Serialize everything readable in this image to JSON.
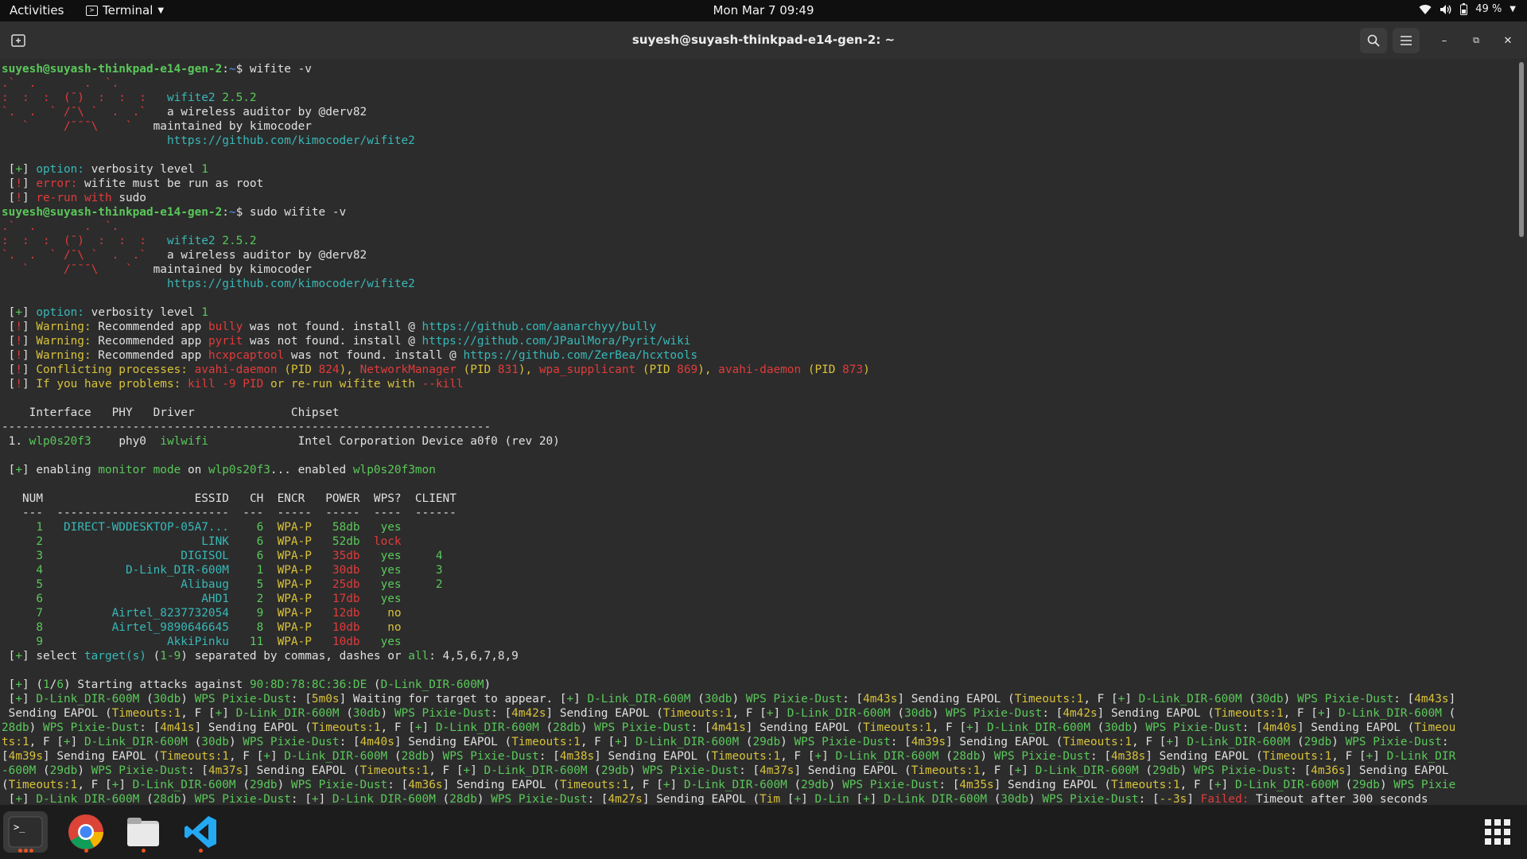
{
  "topbar": {
    "activities": "Activities",
    "app_menu": "Terminal",
    "clock": "Mon Mar 7  09:49",
    "battery": "49 %"
  },
  "window": {
    "title": "suyesh@suyash-thinkpad-e14-gen-2: ~"
  },
  "terminal": {
    "prompt_user": "suyesh@suyash-thinkpad-e14-gen-2",
    "prompt_path": "~",
    "cmd1": "wifite -v",
    "cmd2": "sudo wifite -v",
    "banner_name": "wifite2",
    "banner_version": "2.5.2",
    "banner_l2": "a wireless auditor by @derv82",
    "banner_l3": "maintained by kimocoder",
    "banner_url": "https://github.com/kimocoder/wifite2",
    "opt_label": "option:",
    "opt_text": "verbosity level",
    "opt_value": "1",
    "err_label": "error:",
    "err_text": "wifite must be run as root",
    "rerun": "re-run with",
    "sudo": "sudo",
    "warnings": [
      {
        "app": "bully",
        "url": "https://github.com/aanarchyy/bully"
      },
      {
        "app": "pyrit",
        "url": "https://github.com/JPaulMora/Pyrit/wiki"
      },
      {
        "app": "hcxpcaptool",
        "url": "https://github.com/ZerBea/hcxtools"
      }
    ],
    "iface_header": [
      "Interface",
      "PHY",
      "Driver",
      "Chipset"
    ],
    "iface_row": {
      "num": "1.",
      "iface": "wlp0s20f3",
      "phy": "phy0",
      "driver": "iwlwifi",
      "chipset": "Intel Corporation Device a0f0 (rev 20)"
    },
    "monitor_iface": "wlp0s20f3",
    "monitor_new": "wlp0s20f3mon",
    "targets_header": [
      "NUM",
      "ESSID",
      "CH",
      "ENCR",
      "POWER",
      "WPS?",
      "CLIENT"
    ],
    "targets": [
      {
        "num": "1",
        "essid": "DIRECT-WDDESKTOP-05A7...",
        "ch": "6",
        "encr": "WPA-P",
        "power": "58db",
        "wps": "yes",
        "client": ""
      },
      {
        "num": "2",
        "essid": "LINK",
        "ch": "6",
        "encr": "WPA-P",
        "power": "52db",
        "wps": "lock",
        "client": ""
      },
      {
        "num": "3",
        "essid": "DIGISOL",
        "ch": "6",
        "encr": "WPA-P",
        "power": "35db",
        "wps": "yes",
        "client": "4"
      },
      {
        "num": "4",
        "essid": "D-Link_DIR-600M",
        "ch": "1",
        "encr": "WPA-P",
        "power": "30db",
        "wps": "yes",
        "client": "3"
      },
      {
        "num": "5",
        "essid": "Alibaug",
        "ch": "5",
        "encr": "WPA-P",
        "power": "25db",
        "wps": "yes",
        "client": "2"
      },
      {
        "num": "6",
        "essid": "AHD1",
        "ch": "2",
        "encr": "WPA-P",
        "power": "17db",
        "wps": "yes",
        "client": ""
      },
      {
        "num": "7",
        "essid": "Airtel_8237732054",
        "ch": "9",
        "encr": "WPA-P",
        "power": "12db",
        "wps": "no",
        "client": ""
      },
      {
        "num": "8",
        "essid": "Airtel_9890646645",
        "ch": "8",
        "encr": "WPA-P",
        "power": "10db",
        "wps": "no",
        "client": ""
      },
      {
        "num": "9",
        "essid": "AkkiPinku",
        "ch": "11",
        "encr": "WPA-P",
        "power": "10db",
        "wps": "yes",
        "client": ""
      }
    ],
    "select_prompt": "4,5,6,7,8,9",
    "attack_target_mac": "90:8D:78:8C:36:DE",
    "attack_target_name": "D-Link_DIR-600M",
    "failed": "Failed:",
    "failed_text": "Timeout after 300 seconds"
  }
}
